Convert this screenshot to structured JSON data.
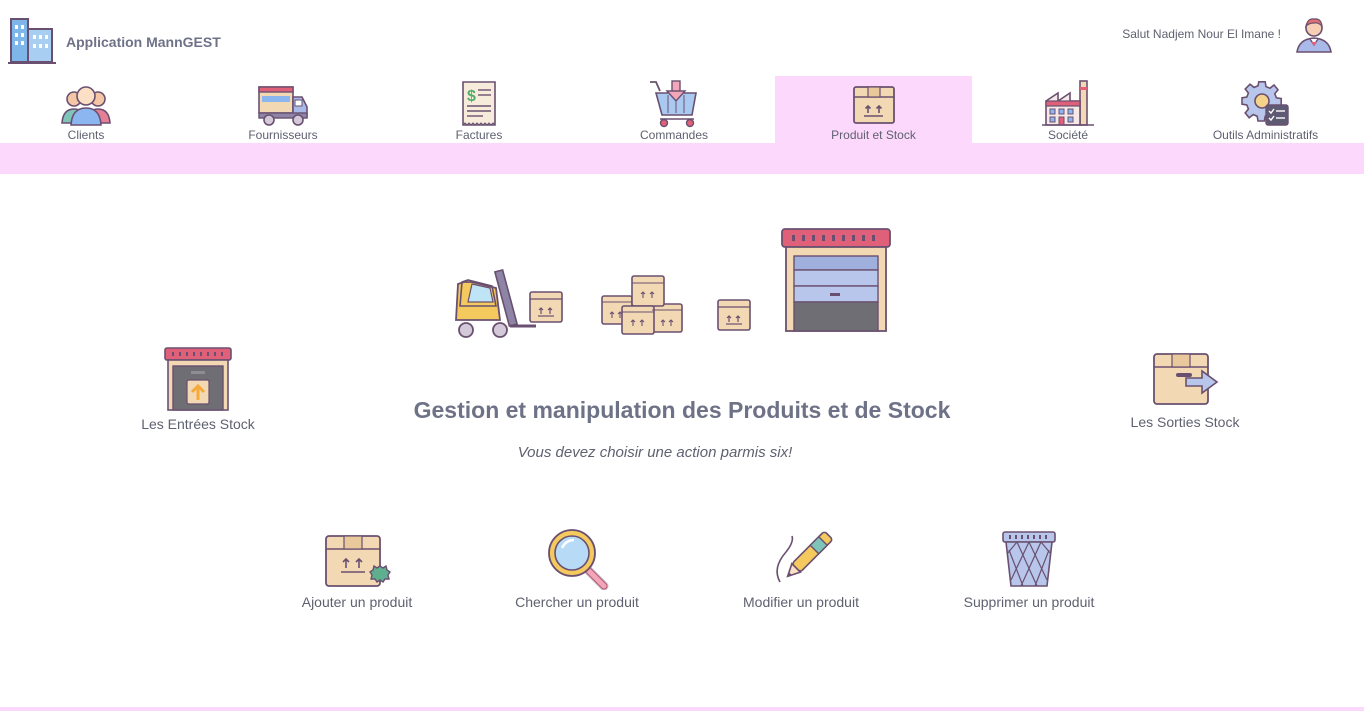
{
  "app": {
    "title": "Application MannGEST"
  },
  "user": {
    "greeting": "Salut Nadjem Nour El Imane !"
  },
  "nav": {
    "items": [
      {
        "label": "Clients"
      },
      {
        "label": "Fournisseurs"
      },
      {
        "label": "Factures"
      },
      {
        "label": "Commandes"
      },
      {
        "label": "Produit et Stock",
        "active": true
      },
      {
        "label": "Société"
      },
      {
        "label": "Outils Administratifs"
      }
    ]
  },
  "page": {
    "title": "Gestion et manipulation des Produits et de Stock",
    "subtitle": "Vous devez choisir une action parmis six!"
  },
  "actions": {
    "entries": "Les Entrées Stock",
    "exits": "Les Sorties Stock",
    "add": "Ajouter un produit",
    "search": "Chercher un produit",
    "edit": "Modifier un produit",
    "delete": "Supprimer un produit"
  },
  "colors": {
    "accent": "#fcd8fd",
    "title": "#6e7287",
    "outline": "#7a5a80",
    "box": "#f3d9b3",
    "red": "#e0607a"
  }
}
